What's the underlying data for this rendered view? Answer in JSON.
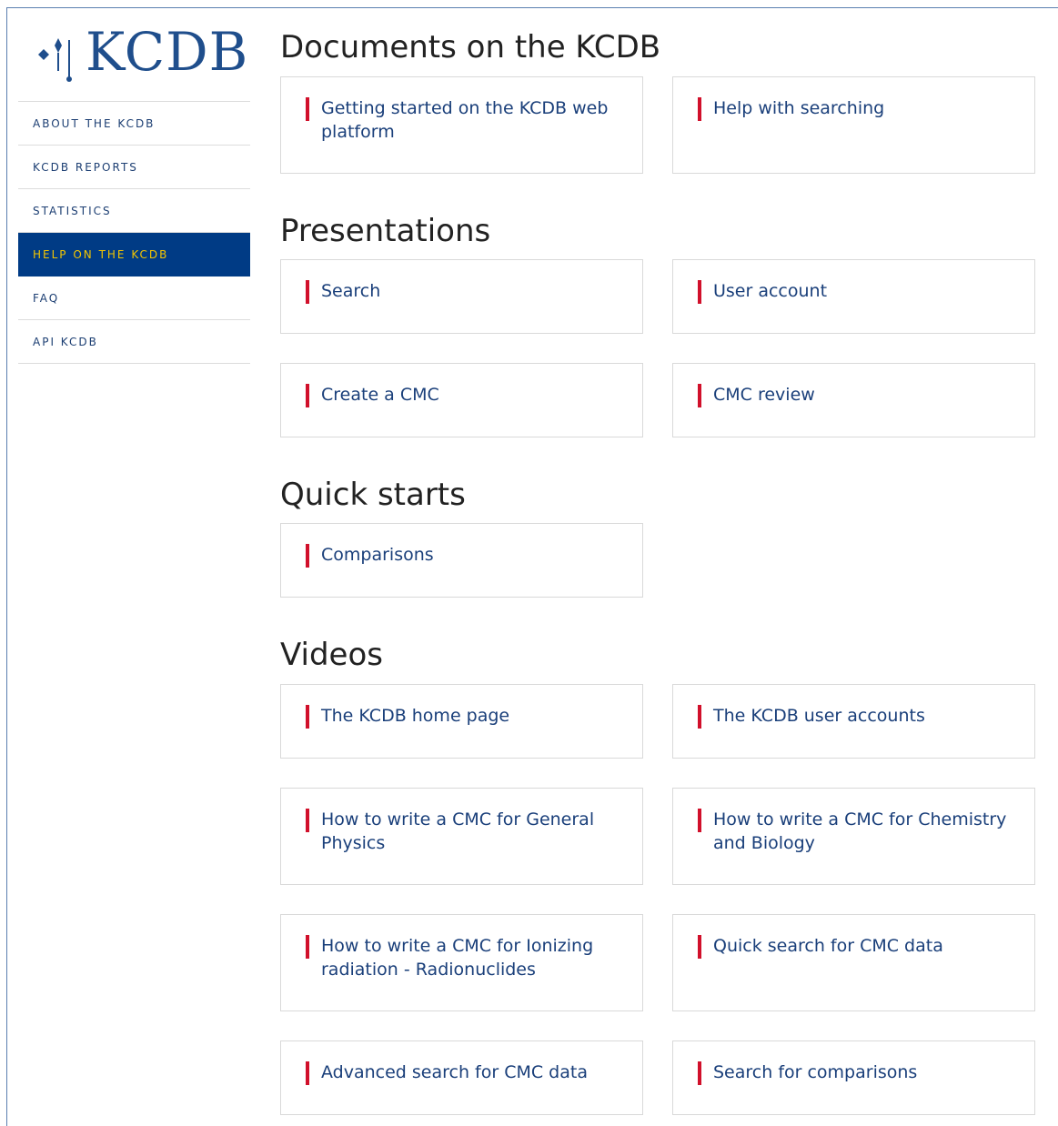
{
  "brand": {
    "logo_text": "KCDB",
    "logo_icon": "kcdb-star-logo-icon",
    "primary_color": "#003b85",
    "accent_color": "#f2c500",
    "marker_color": "#d1102b",
    "link_color": "#1a3f7a"
  },
  "sidebar": {
    "items": [
      {
        "label": "ABOUT THE KCDB",
        "active": false
      },
      {
        "label": "KCDB REPORTS",
        "active": false
      },
      {
        "label": "STATISTICS",
        "active": false
      },
      {
        "label": "HELP ON THE KCDB",
        "active": true
      },
      {
        "label": "FAQ",
        "active": false
      },
      {
        "label": "API KCDB",
        "active": false
      }
    ]
  },
  "sections": {
    "documents": {
      "title": "Documents on the KCDB",
      "items": [
        "Getting started on the KCDB web platform",
        "Help with searching"
      ]
    },
    "presentations": {
      "title": "Presentations",
      "items": [
        "Search",
        "User account",
        "Create a CMC",
        "CMC review"
      ]
    },
    "quickstarts": {
      "title": "Quick starts",
      "items": [
        "Comparisons"
      ]
    },
    "videos": {
      "title": "Videos",
      "items": [
        "The KCDB home page",
        "The KCDB user accounts",
        "How to write a CMC for General Physics",
        "How to write a CMC for Chemistry and Biology",
        "How to write a CMC for Ionizing radiation - Radionuclides",
        "Quick search for CMC data",
        "Advanced search for CMC data",
        "Search for comparisons"
      ]
    }
  }
}
